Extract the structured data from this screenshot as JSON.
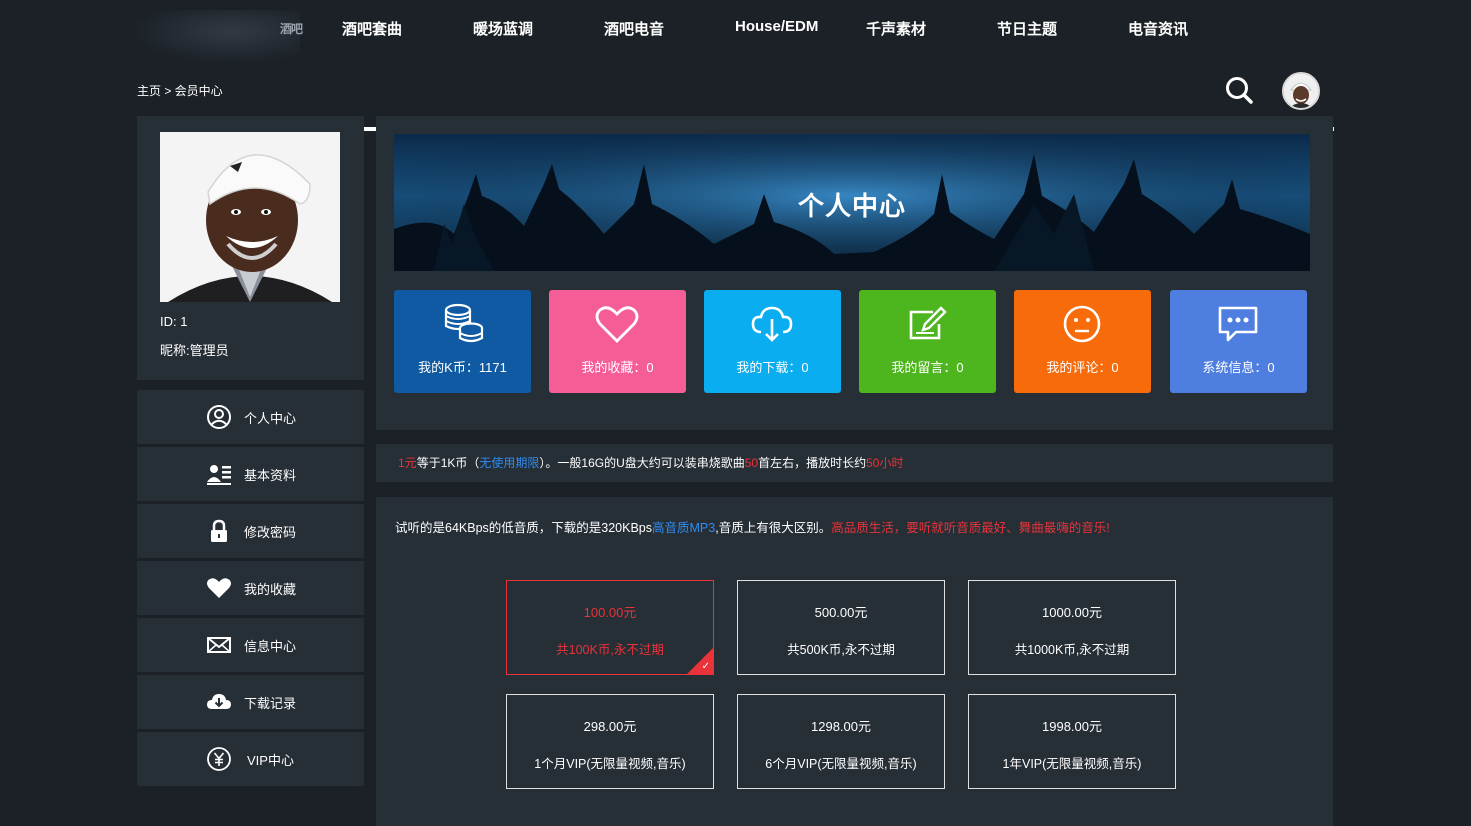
{
  "nav": {
    "logo_text": "酒吧",
    "items": [
      "酒吧套曲",
      "暖场蓝调",
      "酒吧电音",
      "House/EDM",
      "千声素材",
      "节日主题",
      "电音资讯"
    ]
  },
  "breadcrumb": "主页 > 会员中心",
  "profile": {
    "id_text": "ID: 1",
    "nick_text": "昵称:管理员"
  },
  "side_menu": [
    {
      "label": "个人中心",
      "icon": "user-circle-icon"
    },
    {
      "label": "基本资料",
      "icon": "id-card-icon"
    },
    {
      "label": "修改密码",
      "icon": "lock-icon"
    },
    {
      "label": "我的收藏",
      "icon": "heart-icon"
    },
    {
      "label": "信息中心",
      "icon": "envelope-icon"
    },
    {
      "label": "下载记录",
      "icon": "cloud-download-icon"
    },
    {
      "label": "VIP中心",
      "icon": "yen-icon"
    }
  ],
  "banner_title": "个人中心",
  "stats": [
    {
      "label": "我的K币：1171",
      "color": "#0f5aa2",
      "icon": "coins-icon"
    },
    {
      "label": "我的收藏：0",
      "color": "#f45d96",
      "icon": "heart-icon"
    },
    {
      "label": "我的下载：0",
      "color": "#0aaef0",
      "icon": "cloud-download-icon"
    },
    {
      "label": "我的留言：0",
      "color": "#4db51d",
      "icon": "edit-icon"
    },
    {
      "label": "我的评论：0",
      "color": "#f76b0a",
      "icon": "smile-icon"
    },
    {
      "label": "系统信息：0",
      "color": "#4e7fe0",
      "icon": "chat-icon"
    }
  ],
  "info": {
    "p1": "1元",
    "p2": "等于1K币（",
    "p3": "无使用期限",
    "p4": "）。一般16G的U盘大约可以装串烧歌曲",
    "p5": "50",
    "p6": "首左右，播放时长约",
    "p7": "50小时"
  },
  "notice": {
    "p1": "试听的是64KBps的低音质，下载的是320KBps",
    "p2": "高音质MP3",
    "p3": ",音质上有很大区别。",
    "p4": "高品质生活，要听就听音质最好、舞曲最嗨的音乐!"
  },
  "plans": [
    {
      "price": "100.00元",
      "desc": "共100K币,永不过期",
      "selected": true
    },
    {
      "price": "500.00元",
      "desc": "共500K币,永不过期",
      "selected": false
    },
    {
      "price": "1000.00元",
      "desc": "共1000K币,永不过期",
      "selected": false
    },
    {
      "price": "298.00元",
      "desc": "1个月VIP(无限量视频,音乐)",
      "selected": false
    },
    {
      "price": "1298.00元",
      "desc": "6个月VIP(无限量视频,音乐)",
      "selected": false
    },
    {
      "price": "1998.00元",
      "desc": "1年VIP(无限量视频,音乐)",
      "selected": false
    }
  ],
  "check_mark": "✓"
}
